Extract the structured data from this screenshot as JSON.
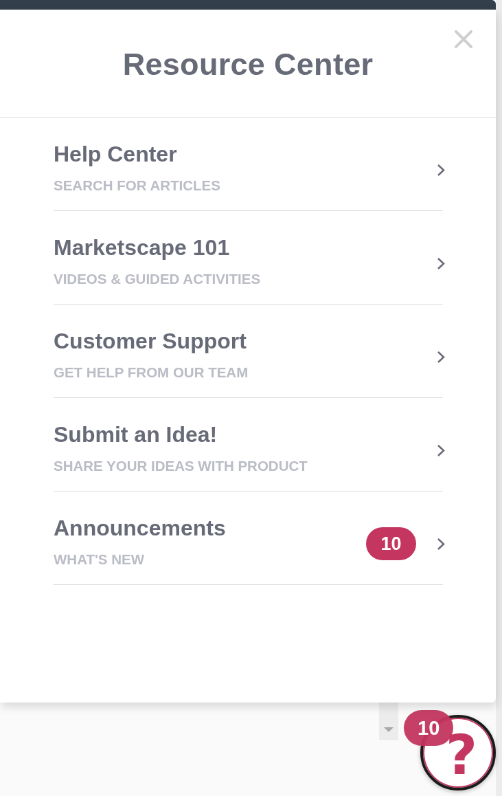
{
  "header": {
    "title": "Resource Center"
  },
  "items": [
    {
      "title": "Help Center",
      "subtitle": "SEARCH FOR ARTICLES"
    },
    {
      "title": "Marketscape 101",
      "subtitle": "VIDEOS & GUIDED ACTIVITIES"
    },
    {
      "title": "Customer Support",
      "subtitle": "GET HELP FROM OUR TEAM"
    },
    {
      "title": "Submit an Idea!",
      "subtitle": "SHARE YOUR IDEAS WITH PRODUCT"
    },
    {
      "title": "Announcements",
      "subtitle": "WHAT'S NEW",
      "badge": "10"
    }
  ],
  "launcher": {
    "symbol": "?",
    "badge": "10"
  }
}
